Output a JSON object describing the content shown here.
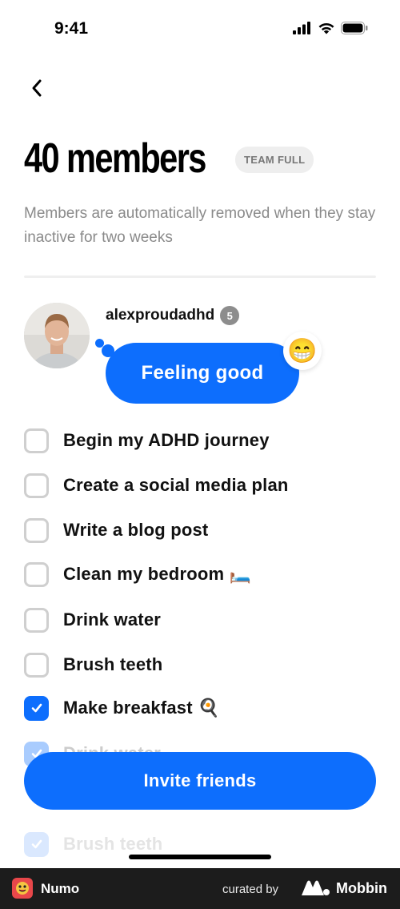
{
  "status_bar": {
    "time": "9:41"
  },
  "header": {
    "title": "40 members",
    "badge": "TEAM FULL",
    "subtitle": "Members are automatically removed when they stay inactive for two weeks"
  },
  "member": {
    "username": "alexproudadhd",
    "streak": "5",
    "status": "Feeling good",
    "emoji": "😁"
  },
  "tasks": [
    {
      "label": "Begin my ADHD journey",
      "checked": false
    },
    {
      "label": "Create a social media plan",
      "checked": false
    },
    {
      "label": "Write a blog post",
      "checked": false
    },
    {
      "label": "Clean my bedroom 🛏️",
      "checked": false
    },
    {
      "label": "Drink water",
      "checked": false
    },
    {
      "label": "Brush teeth",
      "checked": false
    },
    {
      "label": "Make breakfast 🍳",
      "checked": true
    },
    {
      "label": "Drink water",
      "checked": true
    },
    {
      "label": "Brush teeth",
      "checked": true
    }
  ],
  "invite_button": "Invite friends",
  "footer": {
    "app_name": "Numo",
    "curated_by": "curated by",
    "brand": "Mobbin"
  },
  "colors": {
    "accent": "#0d6efd",
    "footer_bg": "#1c1c1c"
  }
}
